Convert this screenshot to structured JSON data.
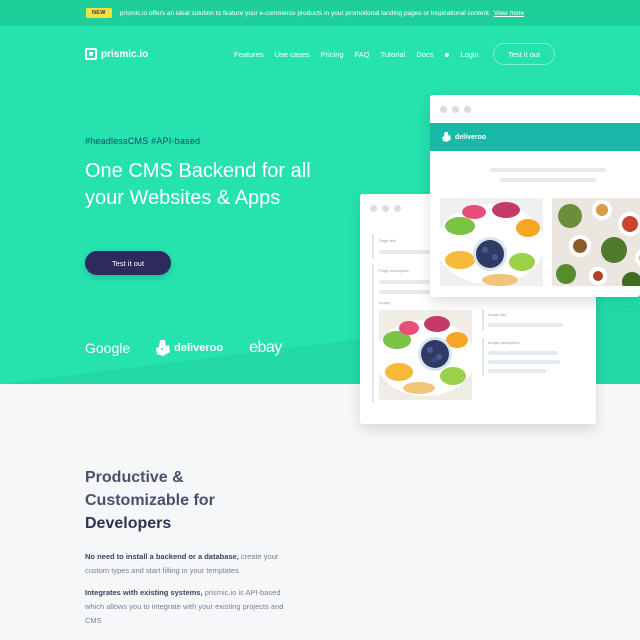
{
  "announcement": {
    "badge": "NEW",
    "message": "prismic.io offers an ideal solution to feature your e-commerce products in your promotional landing pages or inspirational content.",
    "link": "View more"
  },
  "nav": {
    "logo": "prismic.io",
    "items": [
      "Features",
      "Use cases",
      "Pricing",
      "FAQ",
      "Tutorial",
      "Docs"
    ],
    "login": "Login",
    "cta": "Test it out"
  },
  "hero": {
    "tagline": "#headlessCMS #API-based",
    "title": "One CMS Backend for all your Websites & Apps",
    "cta": "Test it out",
    "brands": [
      "Google",
      "deliveroo",
      "ebay"
    ]
  },
  "mock": {
    "brand": "deliveroo",
    "fields": {
      "page_title": "Page title",
      "page_description": "Page description",
      "image": "Image",
      "image_title": "Image title",
      "image_description": "Image description"
    }
  },
  "developers": {
    "title_line1": "Productive &",
    "title_line2": "Customizable for",
    "title_bold": "Developers",
    "p1_bold": "No need to install a backend or a database,",
    "p1_rest": " create your custom types and start filling in your templates",
    "p2_bold": "Integrates with existing systems,",
    "p2_rest": " prismic.io is API-based which allows you to integrate with your existing projects and CMS"
  },
  "colors": {
    "hero": "#25e2af",
    "announce": "#1ecf9a",
    "cta_dark": "#2e2a5e",
    "mock_header": "#19b8a8",
    "badge": "#f5df3f"
  }
}
